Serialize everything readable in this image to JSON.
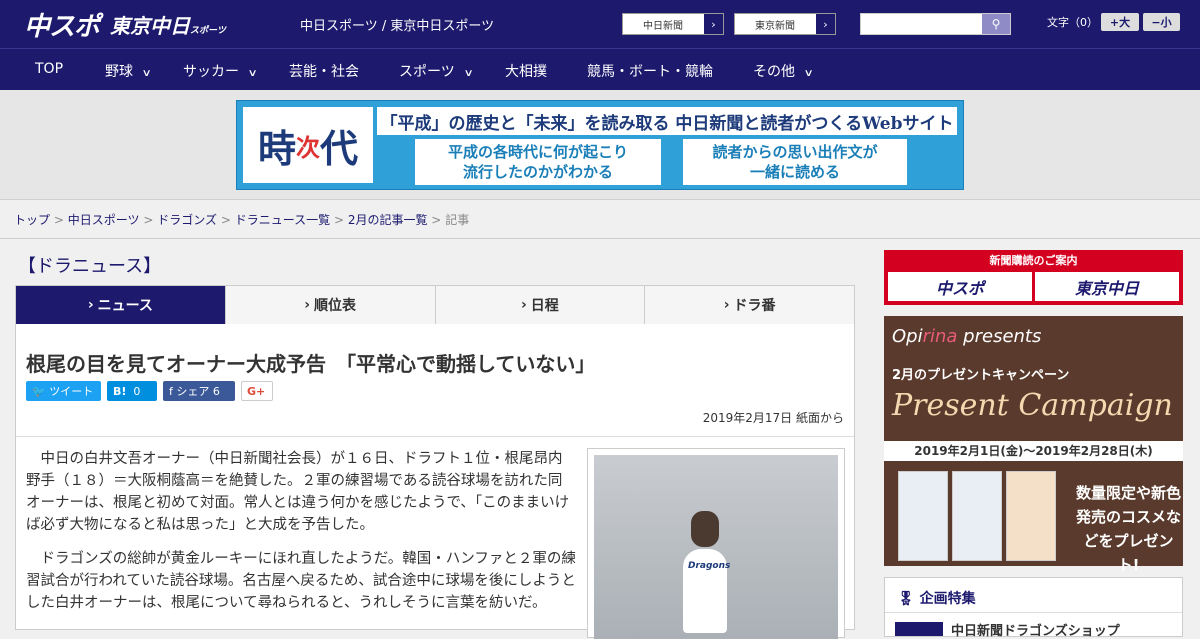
{
  "header": {
    "logo": "中スポ",
    "logo2": "東京中日",
    "logo2_sub": "スポーツ",
    "tagline": "中日スポーツ / 東京中日スポーツ",
    "btn_chunichi": "中日新聞",
    "btn_tokyo": "東京新聞",
    "font_label": "文字（0）",
    "font_bigger": "+大",
    "font_smaller": "−小"
  },
  "nav": [
    {
      "label": "TOP",
      "dropdown": false
    },
    {
      "label": "野球",
      "dropdown": true
    },
    {
      "label": "サッカー",
      "dropdown": true
    },
    {
      "label": "芸能・社会",
      "dropdown": false
    },
    {
      "label": "スポーツ",
      "dropdown": true
    },
    {
      "label": "大相撲",
      "dropdown": false
    },
    {
      "label": "競馬・ボート・競輪",
      "dropdown": false
    },
    {
      "label": "その他",
      "dropdown": true
    }
  ],
  "banner": {
    "logo_a": "時",
    "logo_b": "次",
    "logo_c": "代",
    "headline": "「平成」の歴史と「未来」を読み取る 中日新聞と読者がつくるWebサイト",
    "box1_l1": "平成の各時代に何が起こり",
    "box1_l2": "流行したのかがわかる",
    "box2_l1": "読者からの思い出作文が",
    "box2_l2": "一緒に読める"
  },
  "breadcrumbs": {
    "top": "トップ",
    "c1": "中日スポーツ",
    "c2": "ドラゴンズ",
    "c3": "ドラニュース一覧",
    "c4": "2月の記事一覧",
    "current": "記事",
    "sep": ">"
  },
  "section_title": "【ドラニュース】",
  "tabs": [
    {
      "label": "ニュース",
      "active": true
    },
    {
      "label": "順位表",
      "active": false
    },
    {
      "label": "日程",
      "active": false
    },
    {
      "label": "ドラ番",
      "active": false
    }
  ],
  "article": {
    "title": "根尾の目を見てオーナー大成予告　「平常心で動揺していない」",
    "tweet": "ツイート",
    "hatena": "B!",
    "hatena_count": "0",
    "share": "シェア",
    "share_count": "6",
    "gplus": "G+",
    "date": "2019年2月17日 紙面から",
    "p1": "中日の白井文吾オーナー（中日新聞社会長）が１６日、ドラフト１位・根尾昂内野手（１８）＝大阪桐蔭高＝を絶賛した。２軍の練習場である読谷球場を訪れた同オーナーは、根尾と初めて対面。常人とは違う何かを感じたようで、「このままいけば必ず大物になると私は思った」と大成を予告した。",
    "p2": "ドラゴンズの総帥が黄金ルーキーにほれ直したようだ。韓国・ハンファと２軍の練習試合が行われていた読谷球場。名古屋へ戻るため、試合途中に球場を後にしようとした白井オーナーは、根尾について尋ねられると、うれしそうに言葉を紡いだ。",
    "photo_brand": "Dragons"
  },
  "sidebar": {
    "sub_title": "新聞購読のご案内",
    "sub_b1": "中スポ",
    "sub_b2": "東京中日",
    "camp_brand_a": "Opi",
    "camp_brand_b": "rina",
    "camp_brand_c": " presents",
    "camp_small": "2月のプレゼントキャンペーン",
    "camp_big": "Present Campaign",
    "camp_dates": "2019年2月1日(金)～2019年2月28日(木)",
    "camp_right": "数量限定や新色発売のコスメなどをプレゼント!",
    "special_title": "企画特集",
    "special_row": "中日新聞ドラゴンズショップ"
  },
  "colors": {
    "navy": "#1d1a6e",
    "twitter": "#1da1f2",
    "hatena": "#008fde",
    "facebook": "#3b5998"
  }
}
